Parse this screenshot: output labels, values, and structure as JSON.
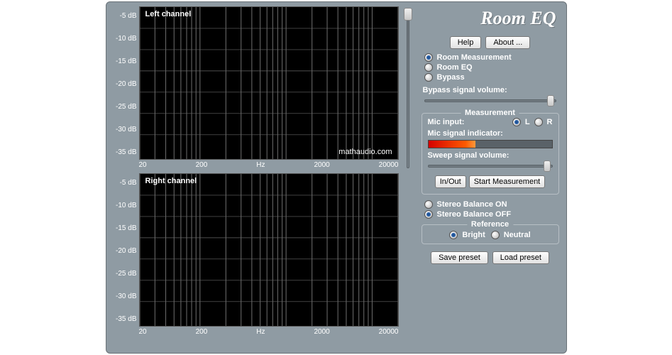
{
  "app_title": "Room EQ",
  "watermark": "mathaudio.com",
  "charts": {
    "left": {
      "title": "Left channel"
    },
    "right": {
      "title": "Right channel"
    },
    "y_ticks": [
      "-5 dB",
      "-10 dB",
      "-15 dB",
      "-20 dB",
      "-25 dB",
      "-30 dB",
      "-35 dB"
    ],
    "x_ticks": [
      "20",
      "200",
      "Hz",
      "2000",
      "20000"
    ]
  },
  "buttons": {
    "help": "Help",
    "about": "About ...",
    "in_out": "In/Out",
    "start_meas": "Start Measurement",
    "save_preset": "Save preset",
    "load_preset": "Load preset"
  },
  "mode": {
    "measurement": "Room Measurement",
    "eq": "Room EQ",
    "bypass": "Bypass",
    "selected": "measurement"
  },
  "bypass_volume_label": "Bypass signal volume:",
  "measurement": {
    "title": "Measurement",
    "mic_input_label": "Mic input:",
    "mic_L": "L",
    "mic_R": "R",
    "mic_selected": "L",
    "mic_indicator_label": "Mic signal indicator:",
    "sweep_label": "Sweep signal volume:"
  },
  "stereo": {
    "on": "Stereo Balance ON",
    "off": "Stereo Balance OFF",
    "selected": "off"
  },
  "reference": {
    "title": "Reference",
    "bright": "Bright",
    "neutral": "Neutral",
    "selected": "bright"
  },
  "chart_data": [
    {
      "type": "line",
      "title": "Left channel",
      "xlabel": "Hz",
      "ylabel": "dB",
      "x_scale": "log",
      "xlim": [
        20,
        20000
      ],
      "ylim": [
        -35,
        -5
      ],
      "series": [],
      "grid": true
    },
    {
      "type": "line",
      "title": "Right channel",
      "xlabel": "Hz",
      "ylabel": "dB",
      "x_scale": "log",
      "xlim": [
        20,
        20000
      ],
      "ylim": [
        -35,
        -5
      ],
      "series": [],
      "grid": true
    }
  ]
}
